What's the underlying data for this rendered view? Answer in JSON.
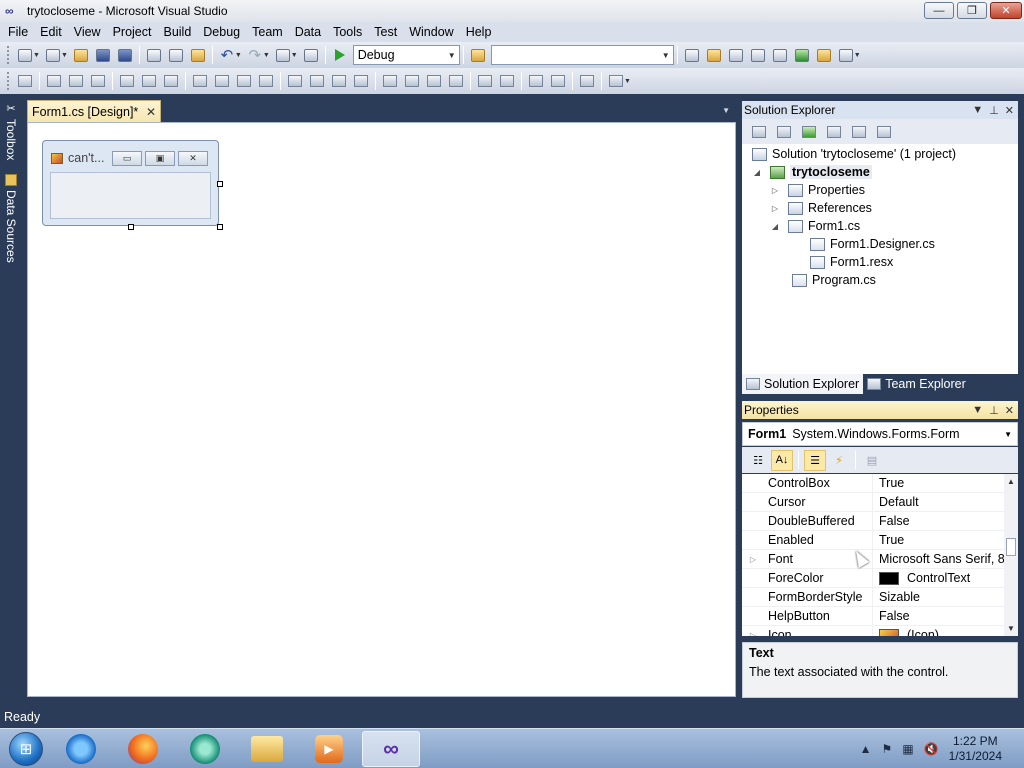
{
  "window": {
    "title": "trytocloseme - Microsoft Visual Studio",
    "controls": [
      "—",
      "❐",
      "✕"
    ]
  },
  "menu": [
    "File",
    "Edit",
    "View",
    "Project",
    "Build",
    "Debug",
    "Team",
    "Data",
    "Tools",
    "Test",
    "Window",
    "Help"
  ],
  "toolbar": {
    "config": "Debug",
    "platform": ""
  },
  "left_rail": {
    "toolbox": "Toolbox",
    "data_sources": "Data Sources"
  },
  "document_tab": {
    "label": "Form1.cs [Design]*",
    "close": "✕"
  },
  "designer": {
    "form_caption": "can't..."
  },
  "solution_explorer": {
    "title": "Solution Explorer",
    "tree": [
      {
        "label": "Solution 'trytocloseme' (1 project)",
        "exp": ""
      },
      {
        "label": "trytocloseme",
        "exp": "◢"
      },
      {
        "label": "Properties",
        "exp": "▷"
      },
      {
        "label": "References",
        "exp": "▷"
      },
      {
        "label": "Form1.cs",
        "exp": "◢"
      },
      {
        "label": "Form1.Designer.cs",
        "exp": ""
      },
      {
        "label": "Form1.resx",
        "exp": ""
      },
      {
        "label": "Program.cs",
        "exp": ""
      }
    ],
    "bottom_tabs": [
      "Solution Explorer",
      "Team Explorer"
    ]
  },
  "properties": {
    "title": "Properties",
    "object_name": "Form1",
    "object_type": "System.Windows.Forms.Form",
    "rows": [
      {
        "name": "ControlBox",
        "value": "True",
        "expand": ""
      },
      {
        "name": "Cursor",
        "value": "Default",
        "expand": ""
      },
      {
        "name": "DoubleBuffered",
        "value": "False",
        "expand": ""
      },
      {
        "name": "Enabled",
        "value": "True",
        "expand": ""
      },
      {
        "name": "Font",
        "value": "Microsoft Sans Serif, 8...",
        "expand": "▷"
      },
      {
        "name": "ForeColor",
        "value": "ControlText",
        "expand": ""
      },
      {
        "name": "FormBorderStyle",
        "value": "Sizable",
        "expand": ""
      },
      {
        "name": "HelpButton",
        "value": "False",
        "expand": ""
      },
      {
        "name": "Icon",
        "value": "(Icon)",
        "expand": "▷"
      }
    ],
    "description_title": "Text",
    "description_text": "The text associated with the control."
  },
  "status": {
    "text": "Ready"
  },
  "taskbar": {
    "time": "1:22 PM",
    "date": "1/31/2024"
  },
  "colors": {
    "chrome_dark": "#2b3c59",
    "active_tab": "#f6e6b0",
    "menu_bg": "#d9e0ec"
  }
}
